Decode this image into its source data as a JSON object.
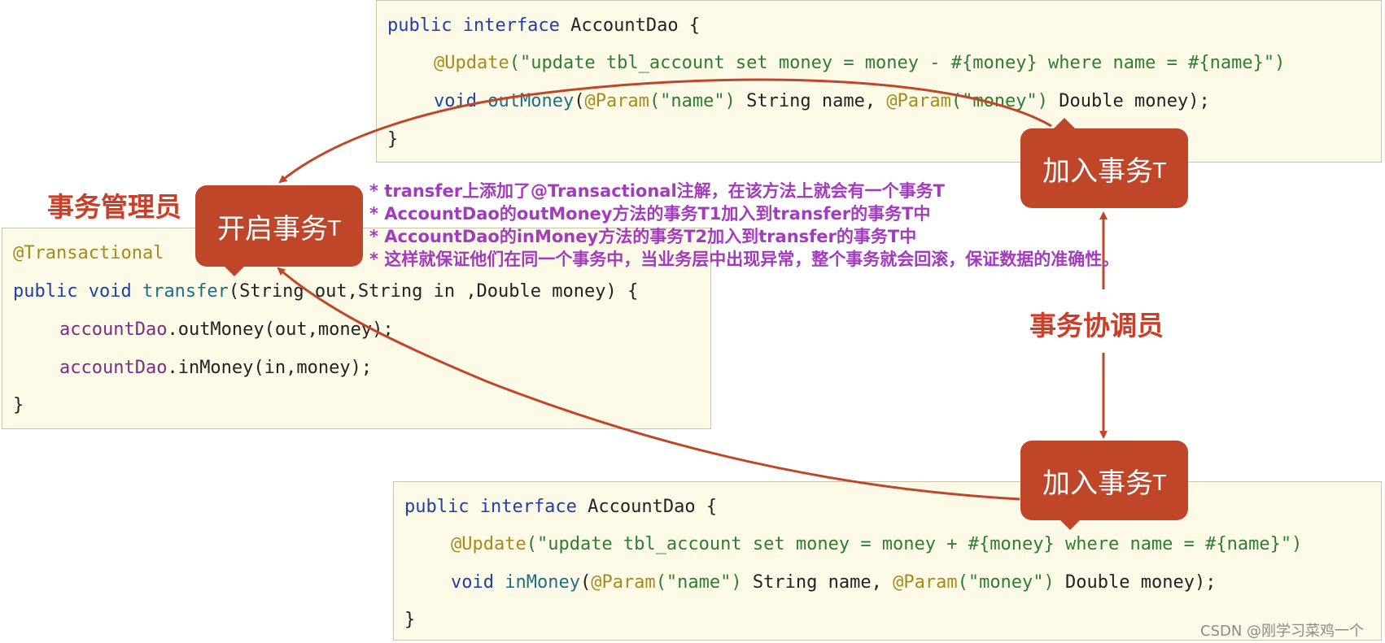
{
  "top_code": {
    "l1_kw": "public interface",
    "l1_rest": " AccountDao {",
    "l2_ann": "@Update",
    "l2_str": "(\"update tbl_account set money = money - #{money} where name = #{name}\")",
    "l3_kw": "void",
    "l3_fn": " outMoney",
    "l3_p1": "(",
    "l3_ann1": "@Param",
    "l3_str1": "(\"name\")",
    "l3_mid": " String name, ",
    "l3_ann2": "@Param",
    "l3_str2": "(\"money\")",
    "l3_end": " Double money);",
    "l4": "}"
  },
  "mid_code": {
    "l1_ann": "@Transactional",
    "l2_kw": "public void",
    "l2_fn": " transfer",
    "l2_rest": "(String out,String in ,Double money) {",
    "l3_field": "accountDao",
    "l3_rest": ".outMoney(out,money);",
    "l4_field": "accountDao",
    "l4_rest": ".inMoney(in,money);",
    "l5": "}"
  },
  "bottom_code": {
    "l1_kw": "public interface",
    "l1_rest": " AccountDao {",
    "l2_ann": "@Update",
    "l2_str": "(\"update tbl_account set money = money + #{money} where name = #{name}\")",
    "l3_kw": "void",
    "l3_fn": " inMoney",
    "l3_p1": "(",
    "l3_ann1": "@Param",
    "l3_str1": "(\"name\")",
    "l3_mid": " String name, ",
    "l3_ann2": "@Param",
    "l3_str2": "(\"money\")",
    "l3_end": " Double money);",
    "l4": "}"
  },
  "bubbles": {
    "start": {
      "main": "开启事务",
      "t": "T"
    },
    "join_top": {
      "main": "加入事务",
      "t": "T"
    },
    "join_bottom": {
      "main": "加入事务",
      "t": "T"
    }
  },
  "labels": {
    "manager": "事务管理员",
    "coordinator": "事务协调员"
  },
  "notes": [
    "* transfer上添加了@Transactional注解，在该方法上就会有一个事务T",
    "* AccountDao的outMoney方法的事务T1加入到transfer的事务T中",
    "* AccountDao的inMoney方法的事务T2加入到transfer的事务T中",
    "* 这样就保证他们在同一个事务中，当业务层中出现异常，整个事务就会回滚，保证数据的准确性。"
  ],
  "watermark": "CSDN @刚学习菜鸡一个",
  "colors": {
    "accent": "#c0462a",
    "note": "#a23bbd",
    "code_bg": "#fdfbe8"
  }
}
